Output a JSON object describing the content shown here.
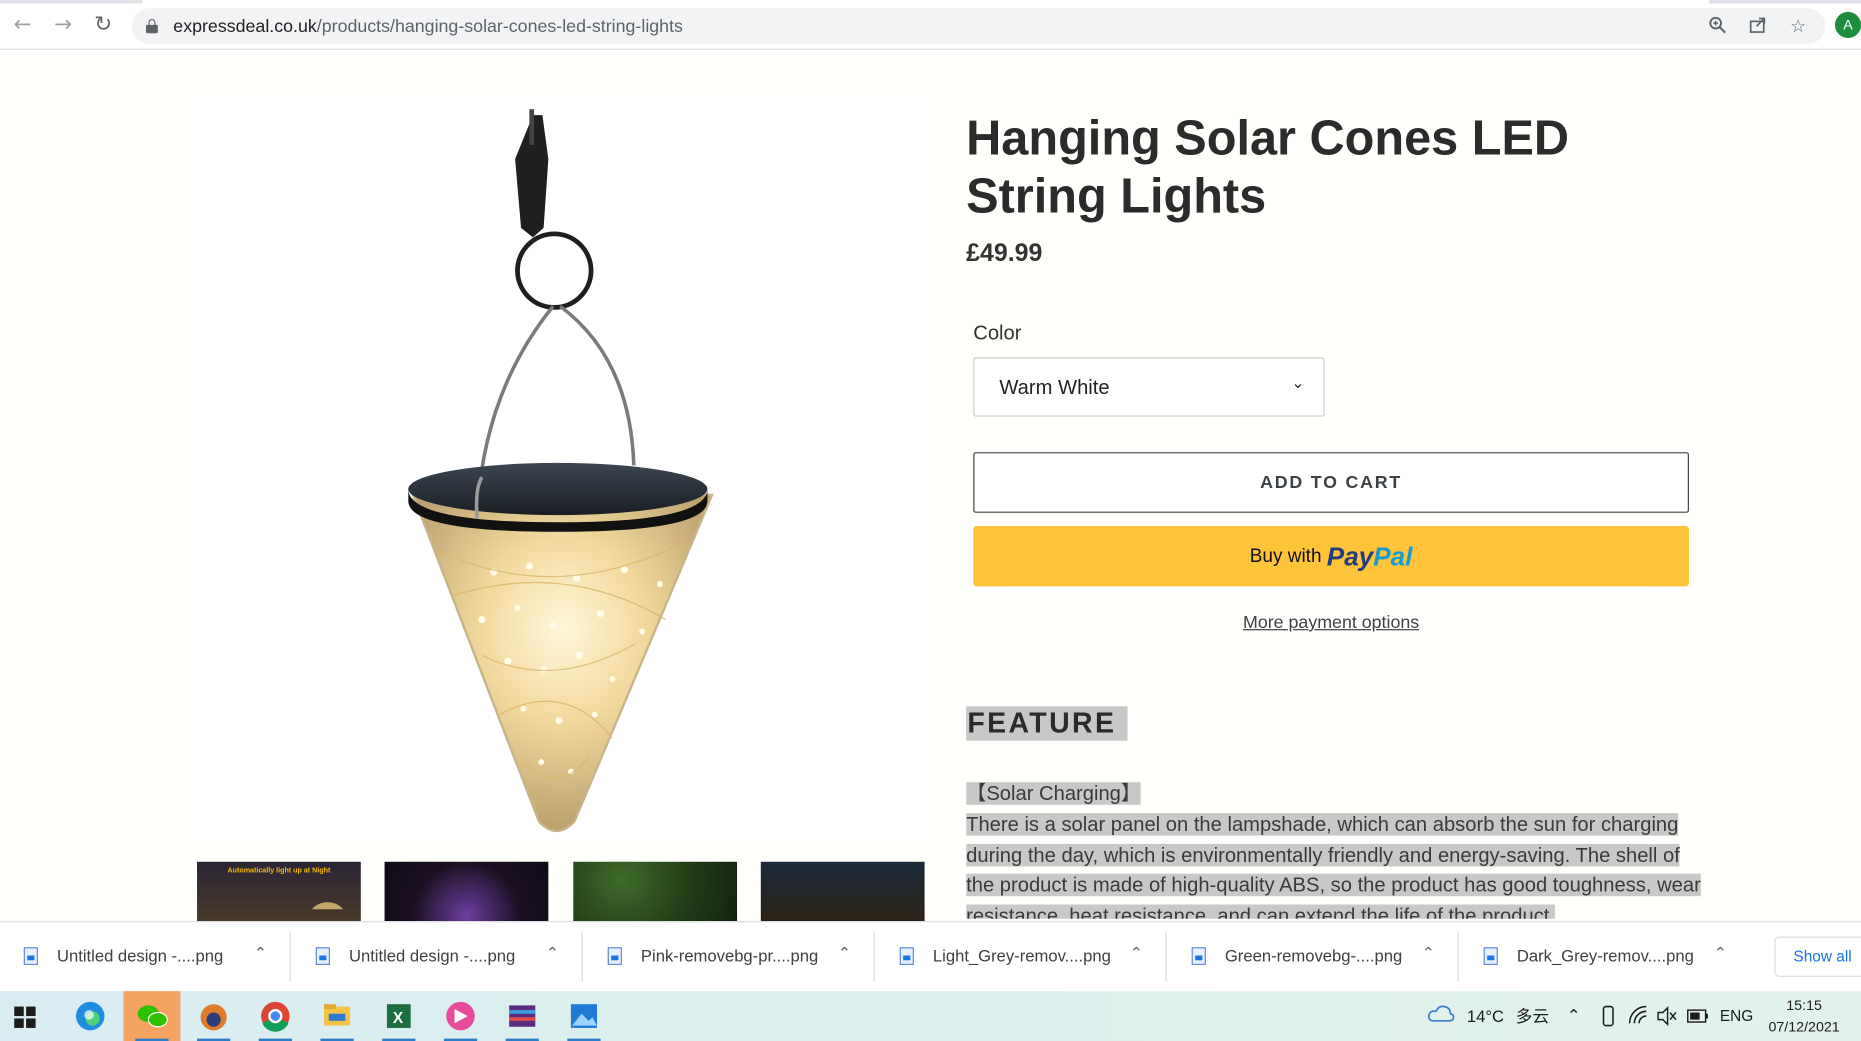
{
  "browser": {
    "url_domain": "expressdeal.co.uk",
    "url_path": "/products/hanging-solar-cones-led-string-lights",
    "profile_initial": "A"
  },
  "product": {
    "title": "Hanging Solar Cones LED String Lights",
    "price": "£49.99",
    "color_label": "Color",
    "color_value": "Warm White",
    "add_to_cart": "ADD TO CART",
    "paypal_prefix": "Buy with",
    "paypal_pay": "Pay",
    "paypal_pal": "Pal",
    "more_payment": "More payment options",
    "feature_heading": "FEATURE",
    "desc_heading": "【Solar Charging】",
    "desc_text": "There is a solar panel on the lampshade, which can absorb the sun for charging during the day, which is environmentally friendly and energy-saving. The shell of the product is made of high-quality ABS, so the product has good toughness, wear resistance, heat resistance, and can extend the life of the product.",
    "thumb1_title": "Automatically light up at Night"
  },
  "downloads": [
    "Untitled design -....png",
    "Untitled design -....png",
    "Pink-removebg-pr....png",
    "Light_Grey-remov....png",
    "Green-removebg-....png",
    "Dark_Grey-remov....png"
  ],
  "show_all": "Show all",
  "taskbar": {
    "temperature": "14°C",
    "weather": "多云",
    "language": "ENG",
    "time": "15:15",
    "date": "07/12/2021"
  }
}
